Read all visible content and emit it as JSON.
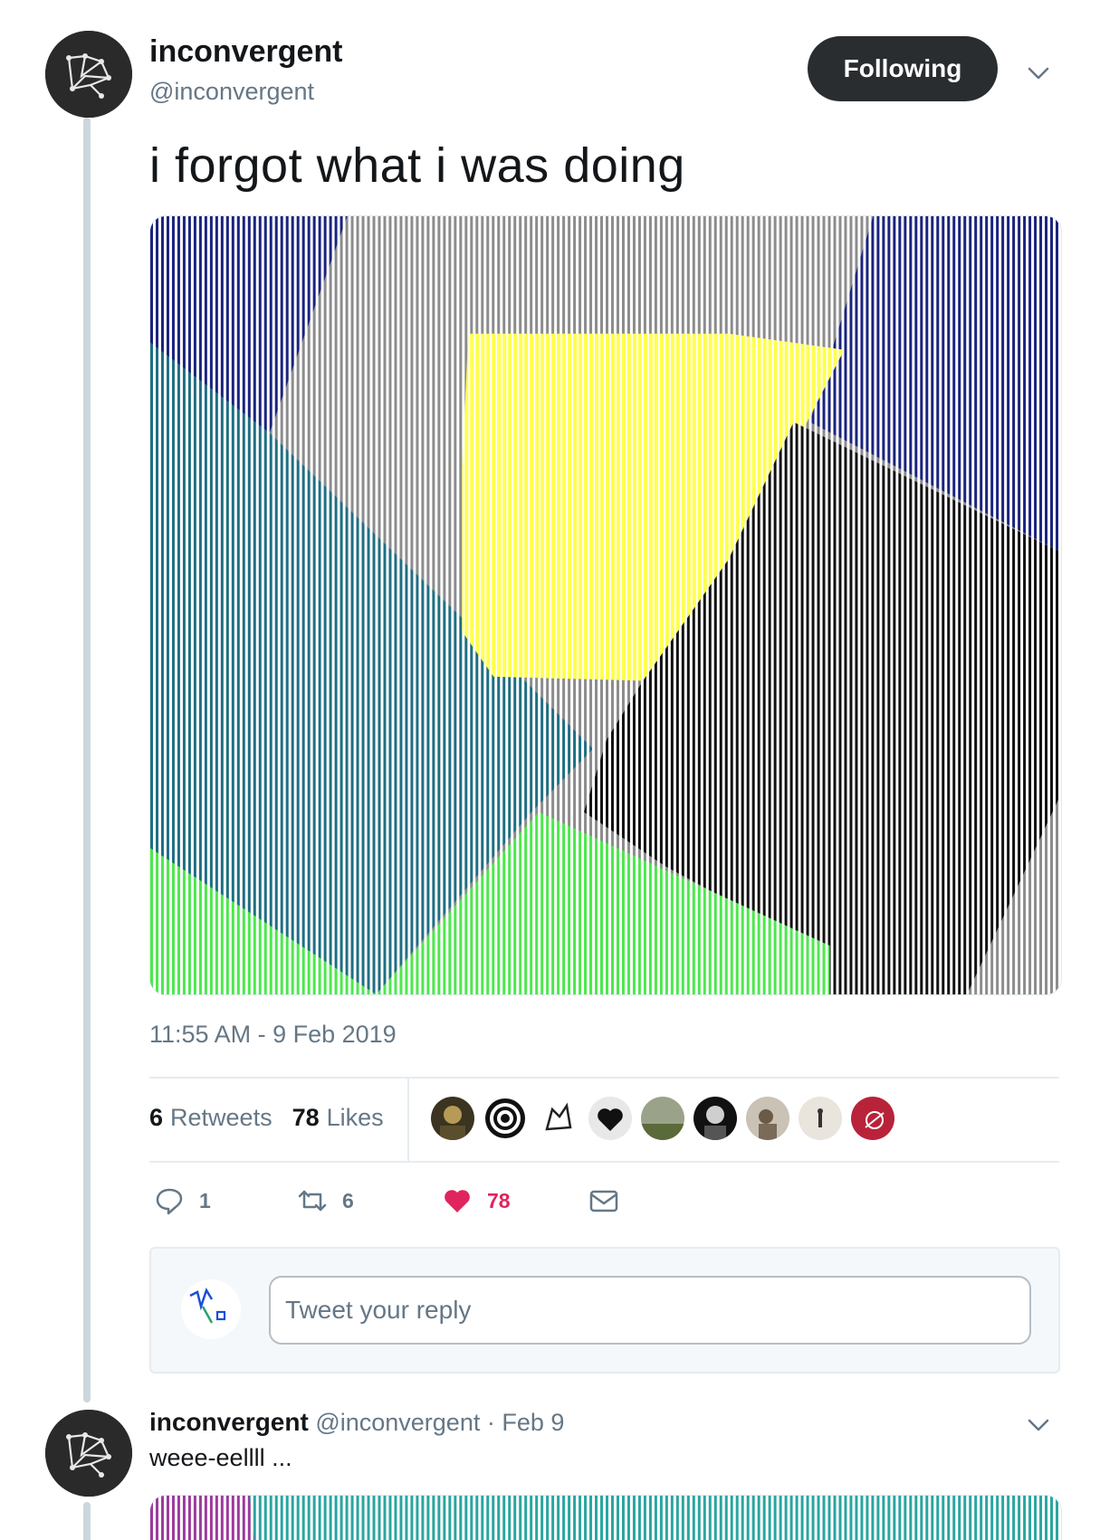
{
  "tweet": {
    "author_name": "inconvergent",
    "author_handle": "@inconvergent",
    "follow_label": "Following",
    "text": "i forgot what i was doing",
    "timestamp": "11:55 AM - 9 Feb 2019",
    "retweets_count": "6",
    "retweets_label": "Retweets",
    "likes_count": "78",
    "likes_label": "Likes",
    "actions": {
      "reply_count": "1",
      "retweet_count": "6",
      "like_count": "78"
    },
    "liker_avatars": [
      "liker-1",
      "liker-2",
      "liker-3",
      "liker-4",
      "liker-5",
      "liker-6",
      "liker-7",
      "liker-8",
      "liker-9"
    ]
  },
  "reply_composer": {
    "placeholder": "Tweet your reply"
  },
  "reply": {
    "author_name": "inconvergent",
    "meta": "@inconvergent · Feb 9",
    "text": "weee-eellll ..."
  },
  "colors": {
    "accent_like": "#e0245e",
    "muted": "#657786",
    "navy": "#1a237e",
    "teal": "#1f6e82",
    "gray": "#8c8c8c",
    "yellow": "#ffff4d",
    "black": "#111111",
    "green": "#4ce84c"
  }
}
